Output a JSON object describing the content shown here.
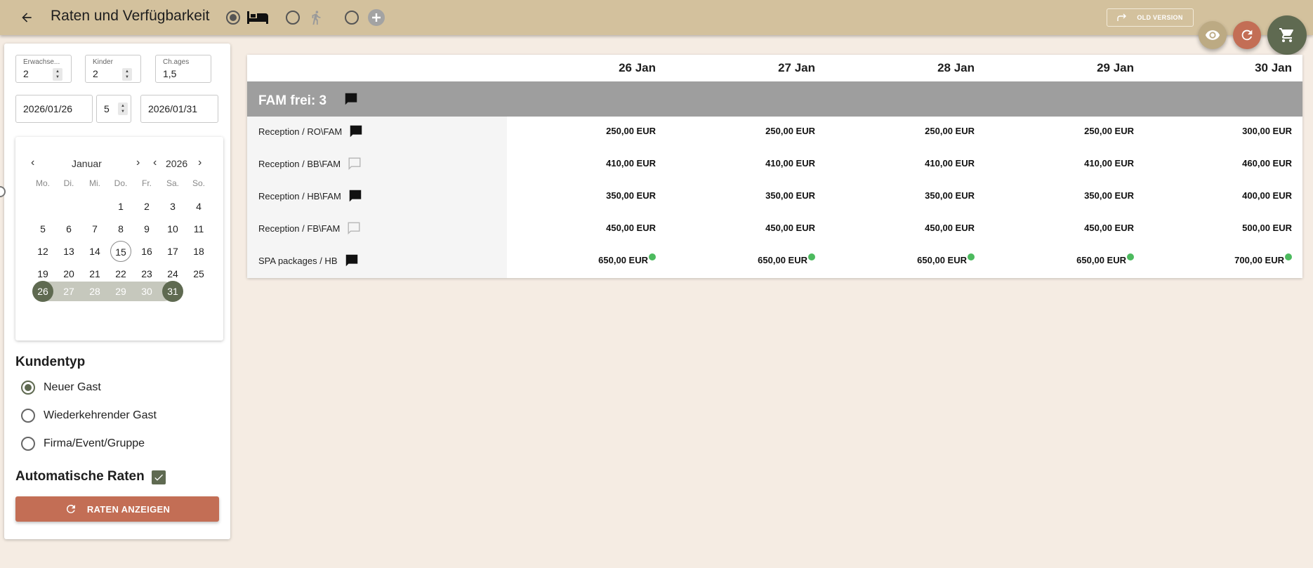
{
  "header": {
    "title": "Raten und Verfügbarkeit",
    "old_version_label": "OLD VERSION",
    "colors": {
      "bar": "#d3c19d",
      "accent": "#5f6a51",
      "action": "#c36e55"
    },
    "modes": [
      {
        "icon": "bed-icon",
        "selected": true
      },
      {
        "icon": "walking-person-icon",
        "selected": false
      },
      {
        "icon": "plus-circle-icon",
        "selected": false
      }
    ]
  },
  "search": {
    "adults": {
      "label": "Erwachse...",
      "value": "2"
    },
    "children": {
      "label": "Kinder",
      "value": "2"
    },
    "child_ages": {
      "label": "Ch.ages",
      "value": "1,5"
    },
    "date_from": "2026/01/26",
    "nights": "5",
    "date_to": "2026/01/31"
  },
  "calendar": {
    "month": "Januar",
    "year": "2026",
    "weekdays": [
      "Mo.",
      "Di.",
      "Mi.",
      "Do.",
      "Fr.",
      "Sa.",
      "So."
    ],
    "weeks": [
      [
        "",
        "",
        "",
        "1",
        "2",
        "3",
        "4"
      ],
      [
        "5",
        "6",
        "7",
        "8",
        "9",
        "10",
        "11"
      ],
      [
        "12",
        "13",
        "14",
        "15",
        "16",
        "17",
        "18"
      ],
      [
        "19",
        "20",
        "21",
        "22",
        "23",
        "24",
        "25"
      ],
      [
        "26",
        "27",
        "28",
        "29",
        "30",
        "31",
        ""
      ]
    ],
    "today": "15",
    "range_start": "26",
    "range_end": "31"
  },
  "customer_type": {
    "title": "Kundentyp",
    "options": [
      {
        "label": "Neuer Gast",
        "selected": true
      },
      {
        "label": "Wiederkehrender Gast",
        "selected": false
      },
      {
        "label": "Firma/Event/Gruppe",
        "selected": false
      }
    ]
  },
  "auto_rates": {
    "label": "Automatische Raten",
    "checked": true
  },
  "show_rates_button": "RATEN ANZEIGEN",
  "rates": {
    "dates": [
      "26 Jan",
      "27 Jan",
      "28 Jan",
      "29 Jan",
      "30 Jan"
    ],
    "group": "FAM frei: 3",
    "rows": [
      {
        "name": "Reception / RO\\FAM",
        "comment": "filled",
        "prices": [
          "250,00 EUR",
          "250,00 EUR",
          "250,00 EUR",
          "250,00 EUR",
          "300,00 EUR"
        ],
        "dot": false
      },
      {
        "name": "Reception / BB\\FAM",
        "comment": "empty",
        "prices": [
          "410,00 EUR",
          "410,00 EUR",
          "410,00 EUR",
          "410,00 EUR",
          "460,00 EUR"
        ],
        "dot": false
      },
      {
        "name": "Reception / HB\\FAM",
        "comment": "filled",
        "prices": [
          "350,00 EUR",
          "350,00 EUR",
          "350,00 EUR",
          "350,00 EUR",
          "400,00 EUR"
        ],
        "dot": false
      },
      {
        "name": "Reception / FB\\FAM",
        "comment": "empty",
        "prices": [
          "450,00 EUR",
          "450,00 EUR",
          "450,00 EUR",
          "450,00 EUR",
          "500,00 EUR"
        ],
        "dot": false
      },
      {
        "name": "SPA packages / HB",
        "comment": "filled",
        "prices": [
          "650,00 EUR",
          "650,00 EUR",
          "650,00 EUR",
          "650,00 EUR",
          "700,00 EUR"
        ],
        "dot": true
      }
    ]
  }
}
